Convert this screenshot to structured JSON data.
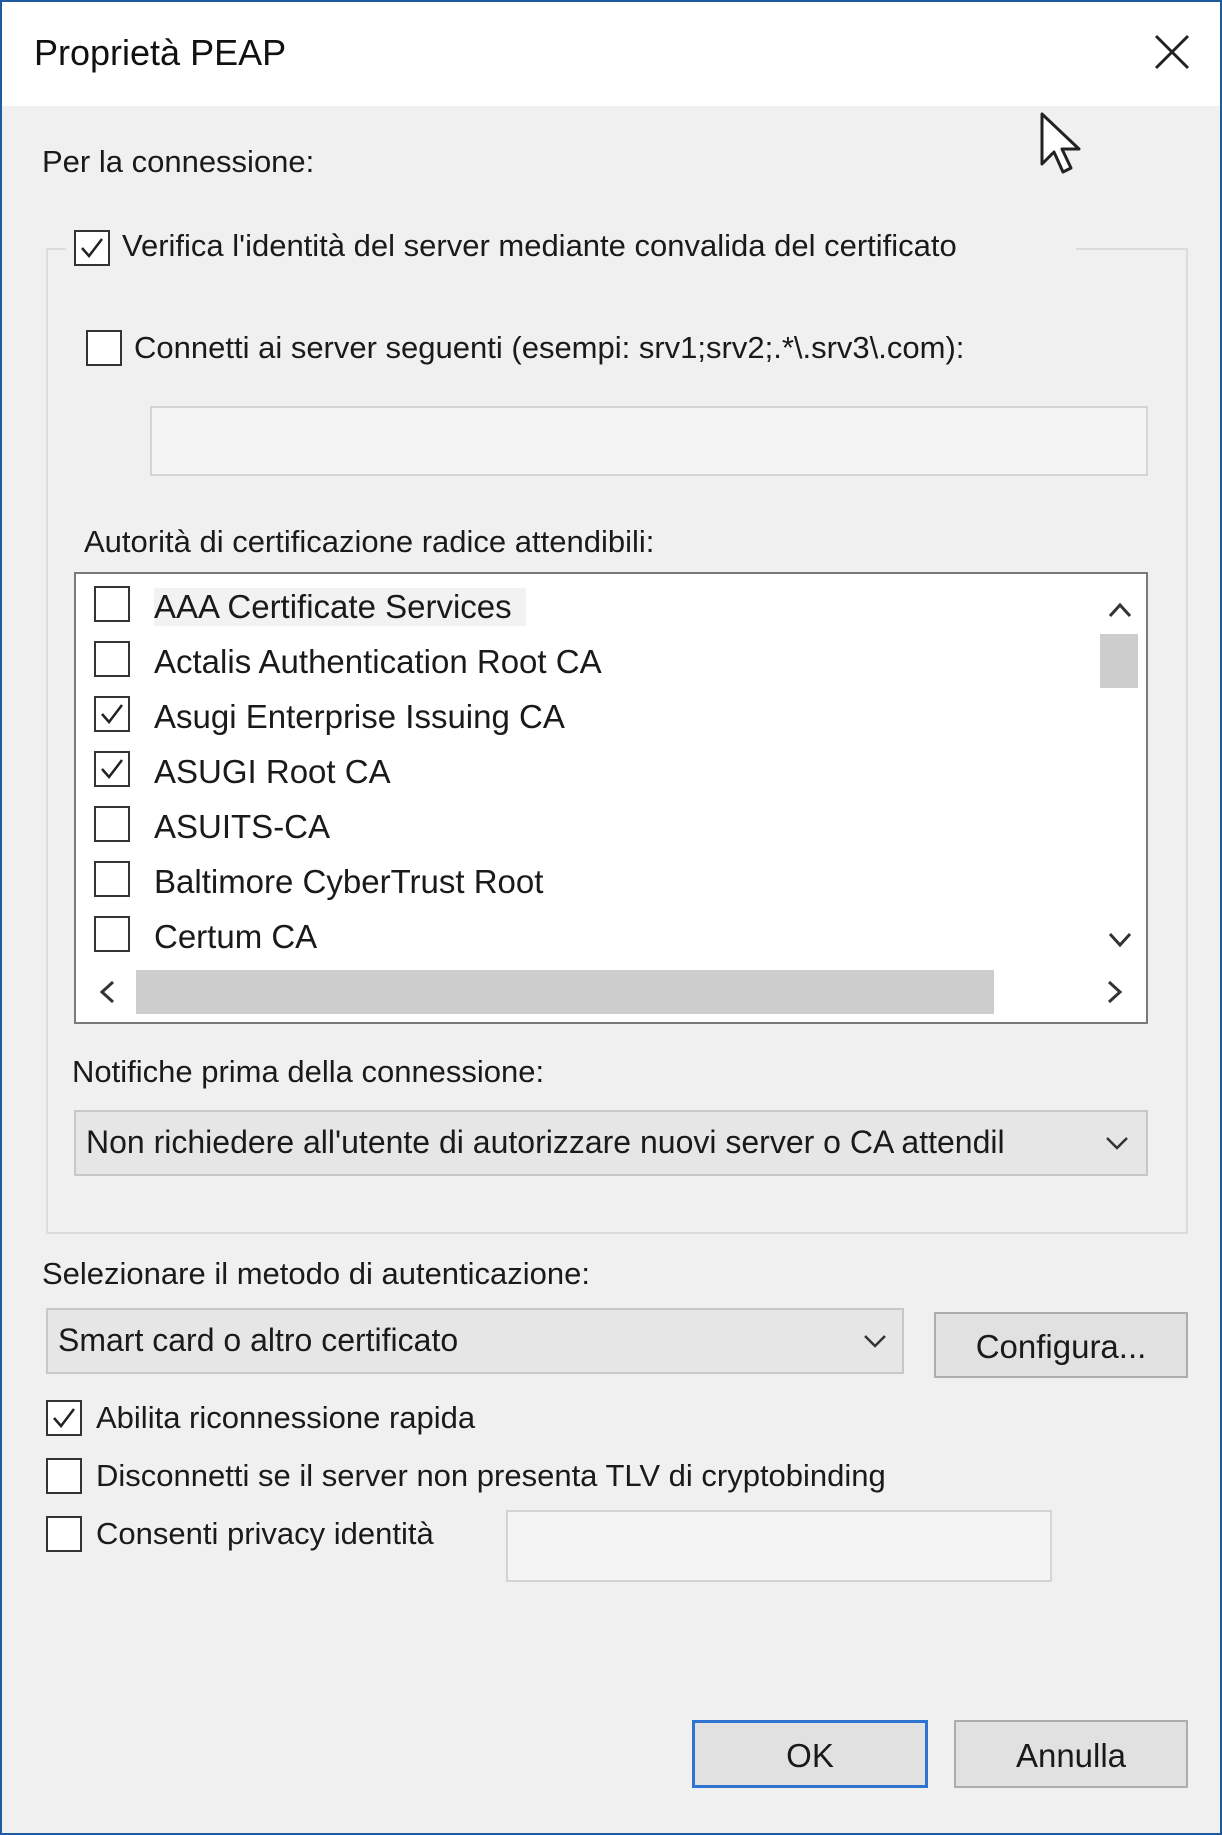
{
  "window": {
    "title": "Proprietà PEAP"
  },
  "connection": {
    "heading": "Per la connessione:",
    "verify_server_label": "Verifica l'identità del server mediante convalida del certificato",
    "verify_server_checked": true,
    "connect_servers_label": "Connetti ai server seguenti (esempi: srv1;srv2;.*\\.srv3\\.com):",
    "connect_servers_checked": false,
    "servers_value": ""
  },
  "root_ca": {
    "heading": "Autorità di certificazione radice attendibili:",
    "items": [
      {
        "name": "AAA Certificate Services",
        "checked": false
      },
      {
        "name": "Actalis Authentication Root CA",
        "checked": false
      },
      {
        "name": "Asugi Enterprise Issuing CA",
        "checked": true
      },
      {
        "name": "ASUGI Root CA",
        "checked": true
      },
      {
        "name": "ASUITS-CA",
        "checked": false
      },
      {
        "name": "Baltimore CyberTrust Root",
        "checked": false
      },
      {
        "name": "Certum CA",
        "checked": false
      }
    ]
  },
  "notifications": {
    "heading": "Notifiche prima della connessione:",
    "selected": "Non richiedere all'utente di autorizzare nuovi server o CA attendil"
  },
  "auth_method": {
    "heading": "Selezionare il metodo di autenticazione:",
    "selected": "Smart card o altro certificato",
    "configure_label": "Configura..."
  },
  "options": {
    "fast_reconnect_label": "Abilita riconnessione rapida",
    "fast_reconnect_checked": true,
    "cryptobinding_label": "Disconnetti se il server non presenta TLV di cryptobinding",
    "cryptobinding_checked": false,
    "identity_privacy_label": "Consenti privacy identità",
    "identity_privacy_checked": false,
    "identity_privacy_value": ""
  },
  "buttons": {
    "ok_label": "OK",
    "cancel_label": "Annulla"
  },
  "colors": {
    "dialog_bg": "#f0f0f0",
    "accent": "#2f74d0",
    "border": "#1e5a9e"
  }
}
